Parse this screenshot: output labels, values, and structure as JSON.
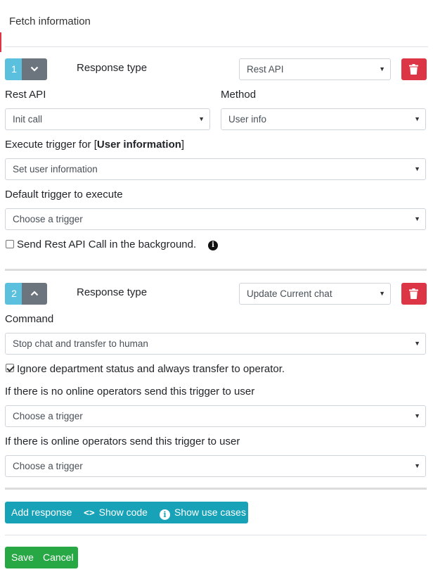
{
  "header": {
    "title": "Fetch information"
  },
  "responses": [
    {
      "number": "1",
      "response_type_label": "Response type",
      "response_type_value": "Rest API",
      "rest_api_label": "Rest API",
      "rest_api_value": "Init call",
      "method_label": "Method",
      "method_value": "User info",
      "execute_trigger_prefix": "Execute trigger for [",
      "execute_trigger_bold": "User information",
      "execute_trigger_suffix": "]",
      "execute_trigger_value": "Set user information",
      "default_trigger_label": "Default trigger to execute",
      "default_trigger_value": "Choose a trigger",
      "background_label": "Send Rest API Call in the background.",
      "background_checked": false
    },
    {
      "number": "2",
      "response_type_label": "Response type",
      "response_type_value": "Update Current chat",
      "command_label": "Command",
      "command_value": "Stop chat and transfer to human",
      "ignore_label": "Ignore department status and always transfer to operator.",
      "ignore_checked": true,
      "no_online_label": "If there is no online operators send this trigger to user",
      "no_online_value": "Choose a trigger",
      "online_label": "If there is online operators send this trigger to user",
      "online_value": "Choose a trigger"
    }
  ],
  "actions": {
    "add_response": "Add response",
    "show_code": "Show code",
    "show_use_cases": "Show use cases",
    "code_icon": "<>",
    "info_icon": "i"
  },
  "footer": {
    "save": "Save",
    "cancel": "Cancel"
  },
  "colors": {
    "info": "#17a2b8",
    "success": "#28a745",
    "danger": "#dc3545",
    "secondary": "#6c757d",
    "badge": "#5bc0de"
  }
}
